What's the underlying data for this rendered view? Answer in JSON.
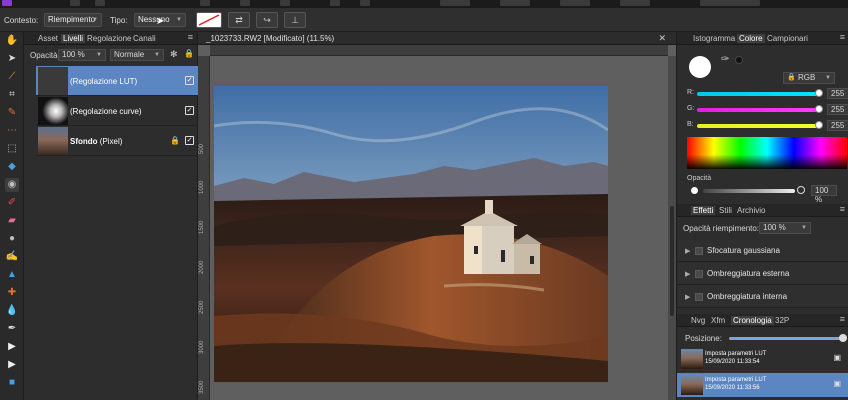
{
  "context_bar": {
    "contesto_label": "Contesto:",
    "contesto_value": "Riempimento",
    "tipo_label": "Tipo:",
    "tipo_value": "Nessuno"
  },
  "layers_panel": {
    "tabs": [
      "Asset",
      "Livelli",
      "Regolazione",
      "Canali"
    ],
    "active_tab": "Livelli",
    "opacity_label": "Opacità:",
    "opacity_value": "100 %",
    "blend_mode": "Normale",
    "layers": [
      {
        "name": "(Regolazione LUT)",
        "selected": true
      },
      {
        "name": "(Regolazione curve)",
        "selected": false
      },
      {
        "name": "Sfondo",
        "suffix": "(Pixel)",
        "selected": false
      }
    ]
  },
  "document": {
    "title": "_1023733.RW2 [Modificato] (11.5%)",
    "ruler_v": [
      "500",
      "1000",
      "1500",
      "2000",
      "2500",
      "3000",
      "3500"
    ]
  },
  "color_panel": {
    "tabs": [
      "Istogramma",
      "Colore",
      "Campionari"
    ],
    "active_tab": "Colore",
    "mode": "RGB",
    "channels": [
      {
        "label": "R:",
        "value": "255",
        "color": "#00e5ff"
      },
      {
        "label": "G:",
        "value": "255",
        "color": "#ff3cff"
      },
      {
        "label": "B:",
        "value": "255",
        "color": "#f2ff2a"
      }
    ],
    "opacity_label": "Opacità",
    "opacity_value": "100 %"
  },
  "effects_panel": {
    "tabs": [
      "Effetti",
      "Stili",
      "Archivio"
    ],
    "active_tab": "Effetti",
    "fill_opacity_label": "Opacità riempimento:",
    "fill_opacity_value": "100 %",
    "effects": [
      "Sfocatura gaussiana",
      "Ombreggiatura esterna",
      "Ombreggiatura interna"
    ]
  },
  "history_panel": {
    "tabs": [
      "Nvg",
      "Xfm",
      "Cronologia",
      "32P"
    ],
    "active_tab": "Cronologia",
    "position_label": "Posizione:",
    "items": [
      {
        "title": "Imposta parametri LUT",
        "time": "15/09/2020 11:33:54",
        "selected": false
      },
      {
        "title": "Imposta parametri LUT",
        "time": "15/09/2020 11:33:56",
        "selected": true
      }
    ]
  },
  "colors": {
    "accent": "#5b86c2",
    "panel_bg": "#2d2d2d",
    "canvas_bg": "#5f5f5f"
  }
}
